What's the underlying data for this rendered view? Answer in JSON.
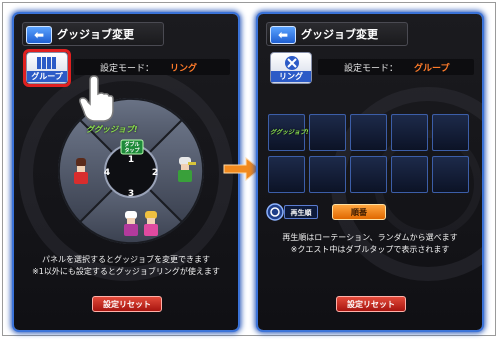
{
  "left_panel": {
    "title": "グッジョブ変更",
    "back_icon": "back-arrow-icon",
    "mode_button_label": "グループ",
    "mode_label": "設定モード：",
    "mode_value": "リング",
    "ring": {
      "badge_top": "ググッジョブ!",
      "double_tap_label": "ダブル\nタップ",
      "segments": [
        "1",
        "2",
        "3",
        "4"
      ]
    },
    "instructions": [
      "パネルを選択するとグッジョブを変更できます",
      "※1以外にも設定するとグッジョブリングが使えます"
    ],
    "reset_label": "設定リセット"
  },
  "right_panel": {
    "title": "グッジョブ変更",
    "back_icon": "back-arrow-icon",
    "mode_button_label": "リング",
    "mode_label": "設定モード：",
    "mode_value": "グループ",
    "first_slot_text": "ググッジョブ!",
    "play_order_label": "再生順",
    "order_button_label": "順番",
    "instructions": [
      "再生順はローテーション、ランダムから選べます",
      "※クエスト中はダブルタップで表示されます"
    ],
    "reset_label": "設定リセット"
  },
  "colors": {
    "panel_glow": "#3b73d8",
    "mode_value": "#ff7b2a",
    "highlight_ring": "#e02020",
    "transition_arrow": "#f28a1e"
  }
}
